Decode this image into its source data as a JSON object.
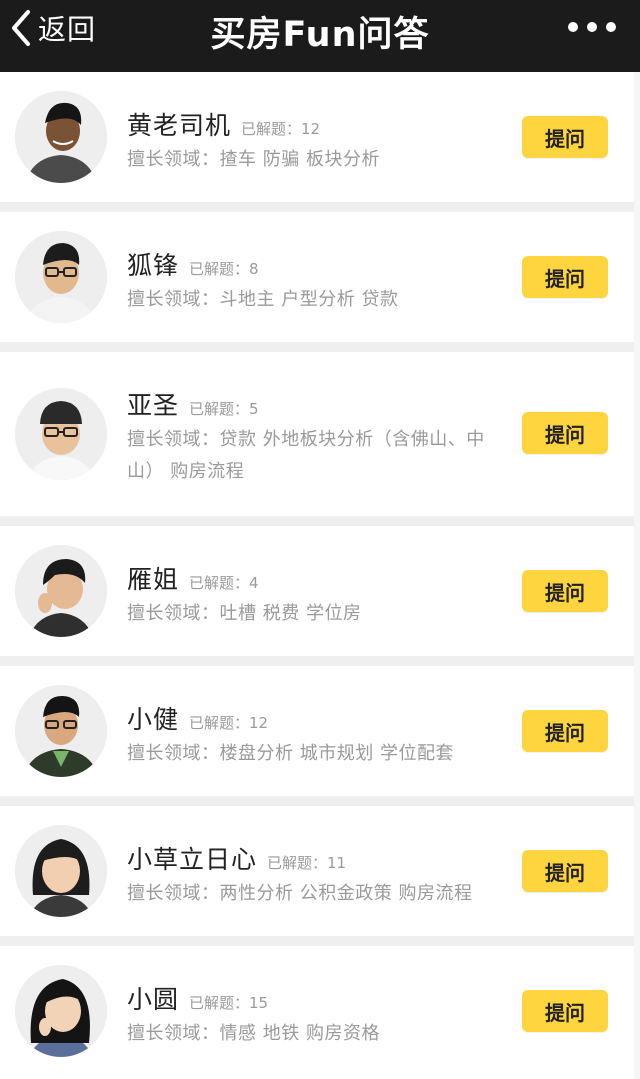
{
  "header": {
    "back_label": "返回",
    "title": "买房Fun问答"
  },
  "experts": [
    {
      "name": "黄老司机",
      "solved": "已解题：12",
      "tags": "擅长领域：揸车 防骗 板块分析",
      "ask_label": "提问"
    },
    {
      "name": "狐锋",
      "solved": "已解题：8",
      "tags": "擅长领域：斗地主 户型分析 贷款",
      "ask_label": "提问"
    },
    {
      "name": "亚圣",
      "solved": "已解题：5",
      "tags": "擅长领域：贷款 外地板块分析（含佛山、中山） 购房流程",
      "ask_label": "提问"
    },
    {
      "name": "雁姐",
      "solved": "已解题：4",
      "tags": "擅长领域：吐槽 税费 学位房",
      "ask_label": "提问"
    },
    {
      "name": "小健",
      "solved": "已解题：12",
      "tags": "擅长领域：楼盘分析 城市规划 学位配套",
      "ask_label": "提问"
    },
    {
      "name": "小草立日心",
      "solved": "已解题：11",
      "tags": "擅长领域：两性分析 公积金政策 购房流程",
      "ask_label": "提问"
    },
    {
      "name": "小圆",
      "solved": "已解题：15",
      "tags": "擅长领域：情感 地铁 购房资格",
      "ask_label": "提问"
    }
  ],
  "colors": {
    "navbar": "#1b1b1b",
    "ask_button": "#ffd53f",
    "divider": "#efefef"
  }
}
